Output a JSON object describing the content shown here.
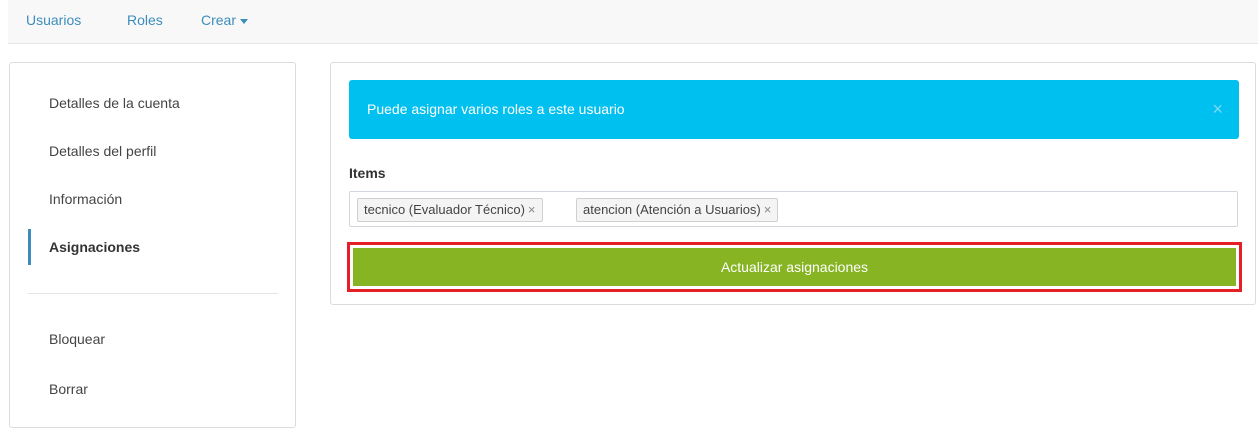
{
  "nav": {
    "users": "Usuarios",
    "roles": "Roles",
    "create": "Crear"
  },
  "sidebar": {
    "items": [
      {
        "label": "Detalles de la cuenta"
      },
      {
        "label": "Detalles del perfil"
      },
      {
        "label": "Información"
      },
      {
        "label": "Asignaciones",
        "active": true
      },
      {
        "label": "Bloquear"
      },
      {
        "label": "Borrar"
      }
    ]
  },
  "alert": {
    "message": "Puede asignar varios roles a este usuario",
    "close": "×",
    "color": "#00c0ef"
  },
  "form": {
    "items_label": "Items",
    "selected": [
      {
        "text": "tecnico (Evaluador Técnico)",
        "remove": "×"
      },
      {
        "text": "atencion (Atención a Usuarios)",
        "remove": "×"
      }
    ],
    "submit_label": "Actualizar asignaciones",
    "submit_color": "#86b423",
    "highlight_color": "#e41f26"
  }
}
